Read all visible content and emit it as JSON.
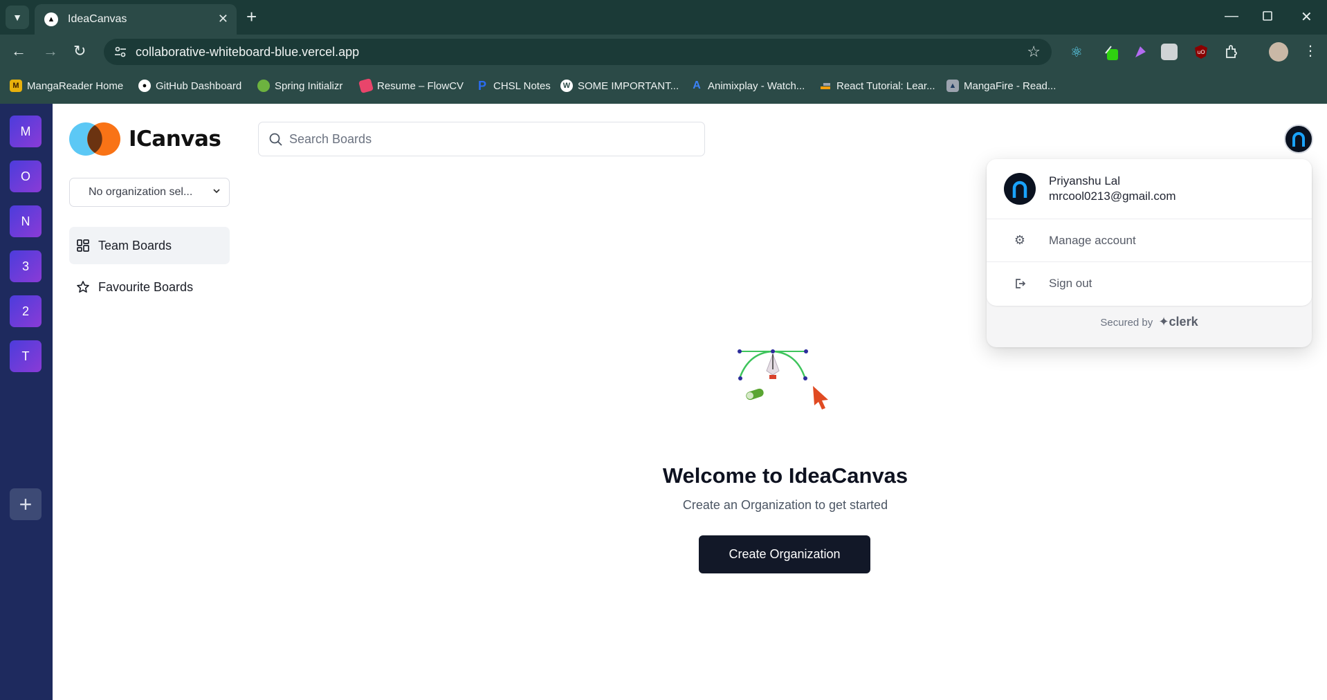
{
  "browser": {
    "tab_title": "IdeaCanvas",
    "url": "collaborative-whiteboard-blue.vercel.app",
    "bookmarks": [
      {
        "label": "MangaReader Home",
        "icon": "manga-icon",
        "color": "#e8b10c"
      },
      {
        "label": "GitHub Dashboard",
        "icon": "github-icon",
        "color": "#ffffff"
      },
      {
        "label": "Spring Initializr",
        "icon": "spring-icon",
        "color": "#6db33f"
      },
      {
        "label": "Resume – FlowCV",
        "icon": "flowcv-icon",
        "color": "#e9456b"
      },
      {
        "label": "CHSL Notes",
        "icon": "notes-icon",
        "color": "#2b6cf0"
      },
      {
        "label": "SOME IMPORTANT...",
        "icon": "wordpress-icon",
        "color": "#ffffff"
      },
      {
        "label": "Animixplay - Watch...",
        "icon": "animix-icon",
        "color": "#3b82f6"
      },
      {
        "label": "React Tutorial: Lear...",
        "icon": "react-bookmark-icon",
        "color": "#f59e0b"
      },
      {
        "label": "MangaFire - Read...",
        "icon": "mangafire-icon",
        "color": "#9ca3af"
      }
    ]
  },
  "orgs": {
    "items": [
      "M",
      "O",
      "N",
      "3",
      "2",
      "T"
    ],
    "add_symbol": "+"
  },
  "sidebar": {
    "logo_text": "ICanvas",
    "org_select": "No organization sel...",
    "nav": [
      {
        "label": "Team Boards",
        "icon": "grid-icon"
      },
      {
        "label": "Favourite Boards",
        "icon": "star-icon"
      }
    ]
  },
  "search": {
    "placeholder": "Search Boards"
  },
  "user_menu": {
    "name": "Priyanshu Lal",
    "email": "mrcool0213@gmail.com",
    "manage": "Manage account",
    "signout": "Sign out",
    "secured_by": "Secured by",
    "secured_brand": "clerk"
  },
  "main": {
    "title": "Welcome to IdeaCanvas",
    "subtitle": "Create an Organization to get started",
    "cta": "Create Organization"
  }
}
